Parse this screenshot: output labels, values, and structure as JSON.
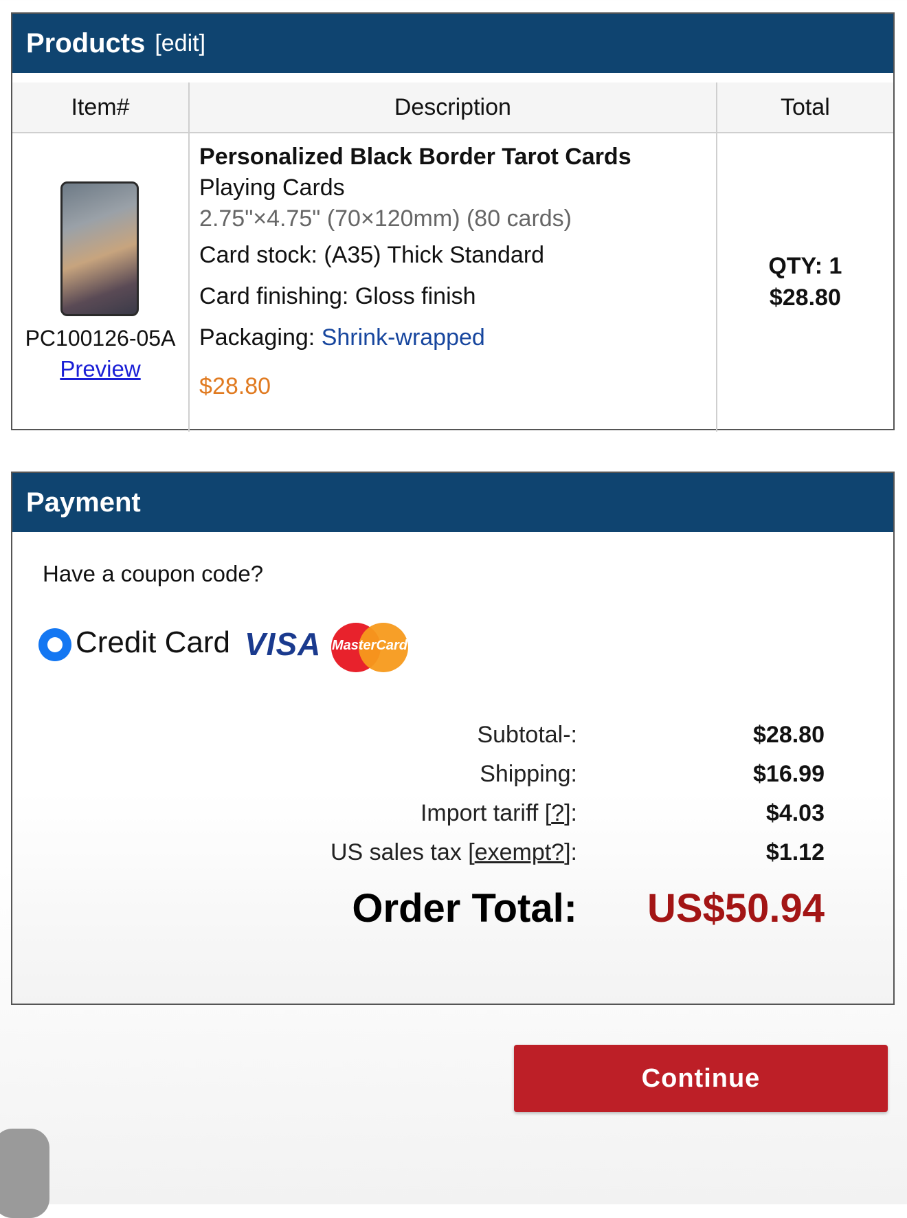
{
  "products": {
    "title": "Products",
    "edit_label": "[edit]",
    "columns": [
      "Item#",
      "Description",
      "Total"
    ],
    "item": {
      "sku": "PC100126-05A",
      "preview_label": "Preview",
      "title": "Personalized Black Border Tarot Cards",
      "subtitle": "Playing Cards",
      "size": "2.75\"×4.75\" (70×120mm) (80 cards)",
      "card_stock": "Card stock: (A35) Thick Standard",
      "card_finishing": "Card finishing: Gloss finish",
      "packaging_label": "Packaging: ",
      "packaging_value": "Shrink-wrapped",
      "price": "$28.80",
      "qty": "QTY: 1",
      "total": "$28.80"
    }
  },
  "payment": {
    "title": "Payment",
    "coupon_prompt": "Have a coupon code?",
    "method_label": "Credit Card",
    "visa_label": "VISA",
    "mastercard_label": "MasterCard",
    "summary": {
      "subtotal_label": "Subtotal-:",
      "subtotal_value": "$28.80",
      "shipping_label": "Shipping:",
      "shipping_value": "$16.99",
      "tariff_label": "Import tariff [",
      "tariff_link": "?",
      "tariff_suffix": "]:",
      "tariff_value": "$4.03",
      "tax_label": "US sales tax [",
      "tax_link": "exempt?",
      "tax_suffix": "]:",
      "tax_value": "$1.12",
      "order_total_label": "Order Total:",
      "order_total_value": "US$50.94"
    }
  },
  "continue_label": "Continue",
  "colors": {
    "header_bg": "#0f4470",
    "continue_bg": "#bd1f27",
    "total_red": "#a31515",
    "price_orange": "#e07a20",
    "radio_blue": "#1477f2"
  }
}
